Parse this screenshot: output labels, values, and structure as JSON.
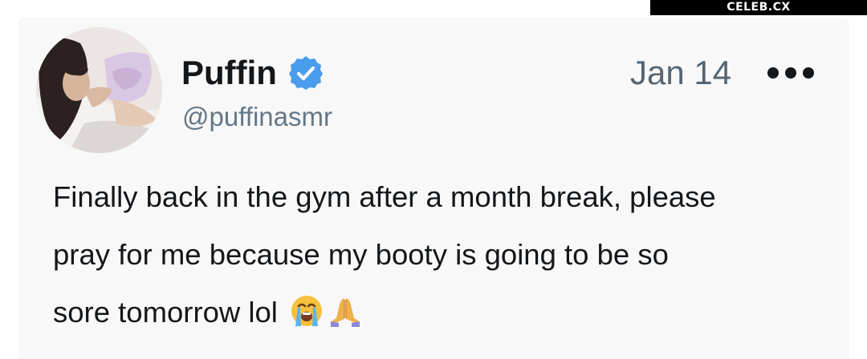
{
  "watermark": {
    "text": "CELEB.CX"
  },
  "tweet": {
    "author": {
      "name": "Puffin",
      "handle": "@puffinasmr",
      "verified": true,
      "avatar_icon": "profile-photo"
    },
    "date": "Jan 14",
    "more_icon": "more-options-icon",
    "text_lines": [
      "Finally back in the gym after a month break, please",
      "pray for me because my booty is going to be so",
      "sore tomorrow lol"
    ],
    "emojis": [
      "loudly-crying-face",
      "folded-hands"
    ]
  },
  "colors": {
    "card_background": "#f8f8f8",
    "verified_blue": "#4a9cec",
    "text_primary": "#14171a",
    "text_secondary": "#657786"
  }
}
